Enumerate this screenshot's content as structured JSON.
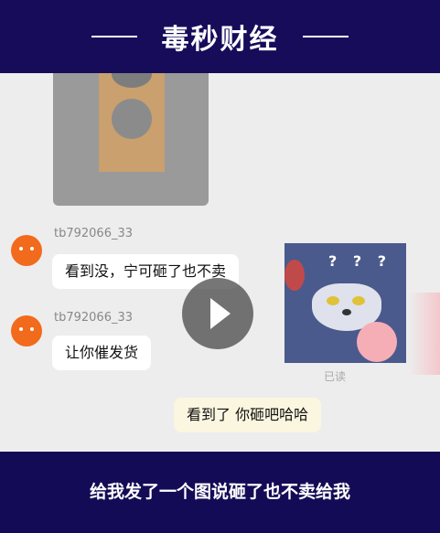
{
  "header": {
    "brand": "毒秒财经"
  },
  "messages": [
    {
      "user": "tb792066_33",
      "text": "看到没，宁可砸了也不卖"
    },
    {
      "user": "tb792066_33",
      "text": "让你催发货"
    },
    {
      "text": "看到了 你砸吧哈哈"
    }
  ],
  "sticker": {
    "text": "? ? ?"
  },
  "status": {
    "read": "已读"
  },
  "caption": "给我发了一个图说砸了也不卖给我",
  "colors": {
    "banner": "#160c5a",
    "chat_bg": "#ededed",
    "avatar": "#f26a1b",
    "mine_bubble": "#fbf6df"
  }
}
